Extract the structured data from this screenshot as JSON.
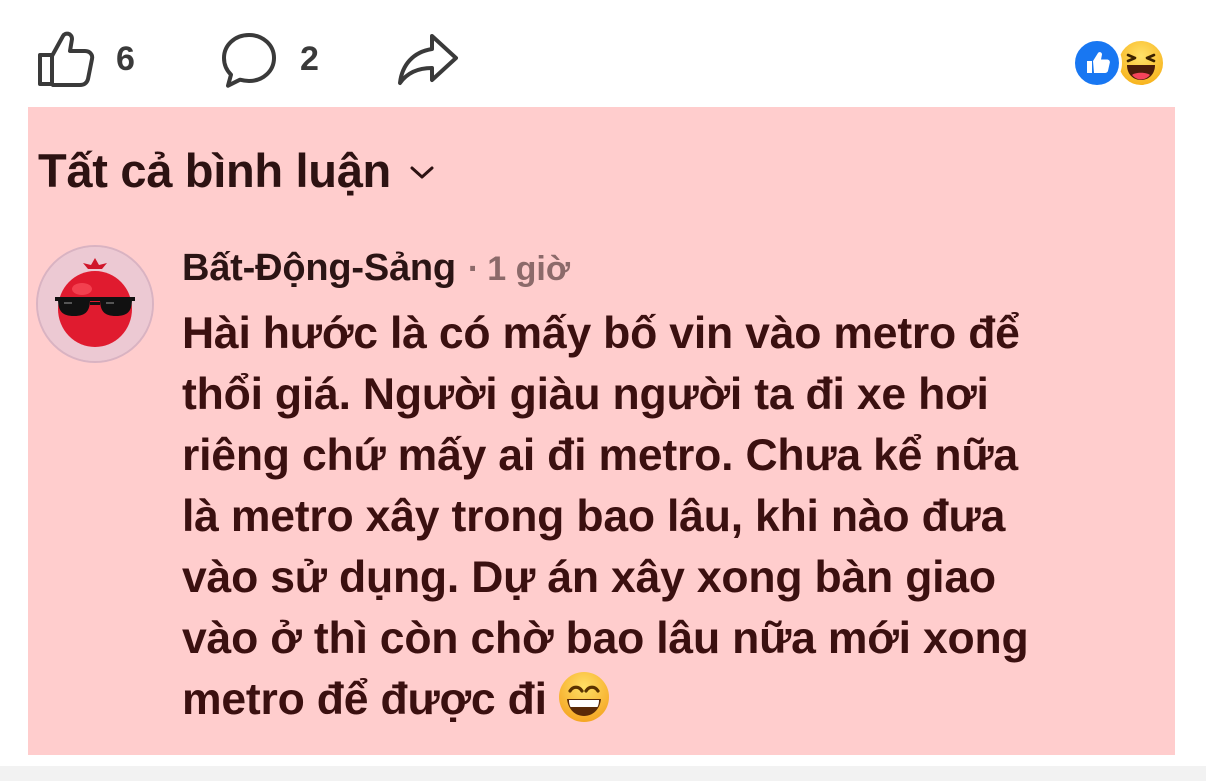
{
  "actions": {
    "like_count": "6",
    "comment_count": "2",
    "like_icon": "thumbs-up-icon",
    "comment_icon": "speech-bubble-icon",
    "share_icon": "share-arrow-icon"
  },
  "reactions": [
    "like-reaction-icon",
    "haha-reaction-icon"
  ],
  "comments_section": {
    "title": "Tất cả bình luận",
    "dropdown_icon": "chevron-down-icon"
  },
  "comment": {
    "author": "Bất-Động-Sảng",
    "separator": "·",
    "time": "1 giờ",
    "body": "Hài hước là có mấy bố vin vào metro để\nthổi giá. Người giàu người ta đi xe hơi\nriêng chứ mấy ai đi metro. Chưa kể nữa\nlà metro xây trong bao lâu, khi nào đưa\nvào sử dụng. Dự án xây xong bàn giao\nvào ở thì còn chờ bao lâu nữa mới xong\nmetro để được đi",
    "trailing_emoji": "grinning-face-icon"
  },
  "colors": {
    "panel_bg": "#ffcdcd",
    "text_dark": "#3b1010",
    "facebook_blue": "#1877f2"
  }
}
